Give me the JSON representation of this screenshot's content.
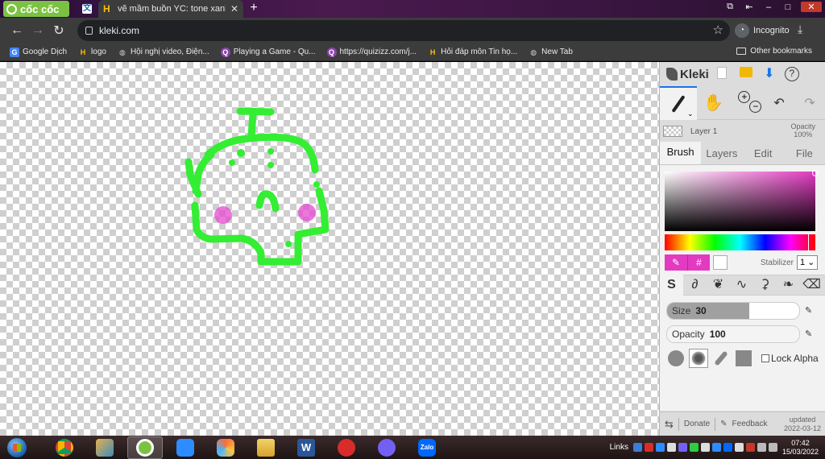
{
  "browser": {
    "brand": "cốc cốc",
    "active_tab_title": "vẽ mầm buồn YC: tone xanh",
    "url": "kleki.com",
    "incognito_label": "Incognito",
    "bookmarks": [
      {
        "label": "Google Dịch",
        "icon": "translate-icon"
      },
      {
        "label": "logo",
        "icon": "hoidap-icon"
      },
      {
        "label": "Hội nghị video, Điện...",
        "icon": "globe-icon"
      },
      {
        "label": "Playing a Game - Qu...",
        "icon": "quizizz-icon"
      },
      {
        "label": "https://quizizz.com/j...",
        "icon": "quizizz-icon"
      },
      {
        "label": "Hỏi đáp môn Tin họ...",
        "icon": "hoidap-icon"
      },
      {
        "label": "New Tab",
        "icon": "globe-icon"
      }
    ],
    "other_bookmarks": "Other bookmarks"
  },
  "kleki": {
    "app_name": "Kleki",
    "layer_name": "Layer 1",
    "opacity_label": "Opacity",
    "opacity_value": "100%",
    "tabs": [
      "Brush",
      "Layers",
      "Edit",
      "File"
    ],
    "active_tab": "Brush",
    "primary_color": "#e23ac0",
    "stabilizer_label": "Stabilizer",
    "stabilizer_value": "1",
    "size_label": "Size",
    "size_value": "30",
    "size_fraction": 0.62,
    "opacity_slider_label": "Opacity",
    "opacity_slider_value": "100",
    "opacity_fraction": 1.0,
    "lock_alpha_label": "Lock Alpha",
    "donate_label": "Donate",
    "feedback_label": "Feedback",
    "updated_label": "updated",
    "updated_date": "2022-03-12"
  },
  "taskbar": {
    "links_label": "Links",
    "time": "07:42",
    "date": "15/03/2022",
    "zalo_label": "Zalo",
    "word_label": "W"
  },
  "drawing_colors": {
    "stroke": "#33ee33",
    "blush": "#e64ad0"
  }
}
